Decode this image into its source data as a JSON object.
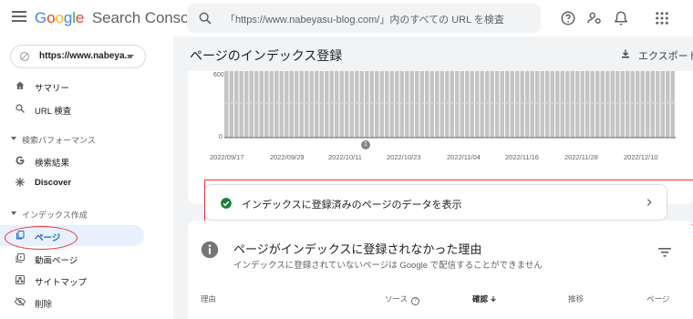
{
  "app": {
    "logo_g1": "G",
    "logo_o1": "o",
    "logo_o2": "o",
    "logo_g2": "g",
    "logo_l": "l",
    "logo_e": "e",
    "logo_product": "Search Console",
    "search_placeholder": "「https://www.nabeyasu-blog.com/」内のすべての URL を検査"
  },
  "sidebar": {
    "property": "https://www.nabeya...",
    "items": [
      {
        "label": "サマリー",
        "icon": "home-icon"
      },
      {
        "label": "URL 検査",
        "icon": "search-icon"
      }
    ],
    "sections": [
      {
        "label": "検索パフォーマンス",
        "items": [
          {
            "label": "検索結果",
            "icon": "google-g-icon"
          },
          {
            "label": "Discover",
            "icon": "asterisk-icon"
          }
        ]
      },
      {
        "label": "インデックス作成",
        "items": [
          {
            "label": "ページ",
            "icon": "pages-icon",
            "active": true
          },
          {
            "label": "動画ページ",
            "icon": "video-pages-icon"
          },
          {
            "label": "サイトマップ",
            "icon": "sitemap-icon"
          },
          {
            "label": "削除",
            "icon": "removals-icon"
          }
        ]
      }
    ]
  },
  "main": {
    "title": "ページのインデックス登録",
    "export_label": "エクスポート",
    "chart": {
      "y_ticks": [
        "600",
        "0"
      ],
      "x_ticks": [
        "2022/09/17",
        "2022/09/29",
        "2022/10/11",
        "2022/10/23",
        "2022/11/04",
        "2022/11/16",
        "2022/11/28",
        "2022/12/10"
      ],
      "marker": "1"
    },
    "indexed_link": "インデックスに登録済みのページのデータを表示",
    "not_indexed": {
      "title": "ページがインデックスに登録されなかった理由",
      "subtitle": "インデックスに登録されていないページは Google で配信することができません",
      "columns": [
        "理由",
        "ソース",
        "確認",
        "推移",
        "ページ"
      ]
    }
  },
  "colors": {
    "accent": "#1967d2",
    "highlight": "#e53935",
    "success": "#188038",
    "bar": "#c4c4c4"
  }
}
